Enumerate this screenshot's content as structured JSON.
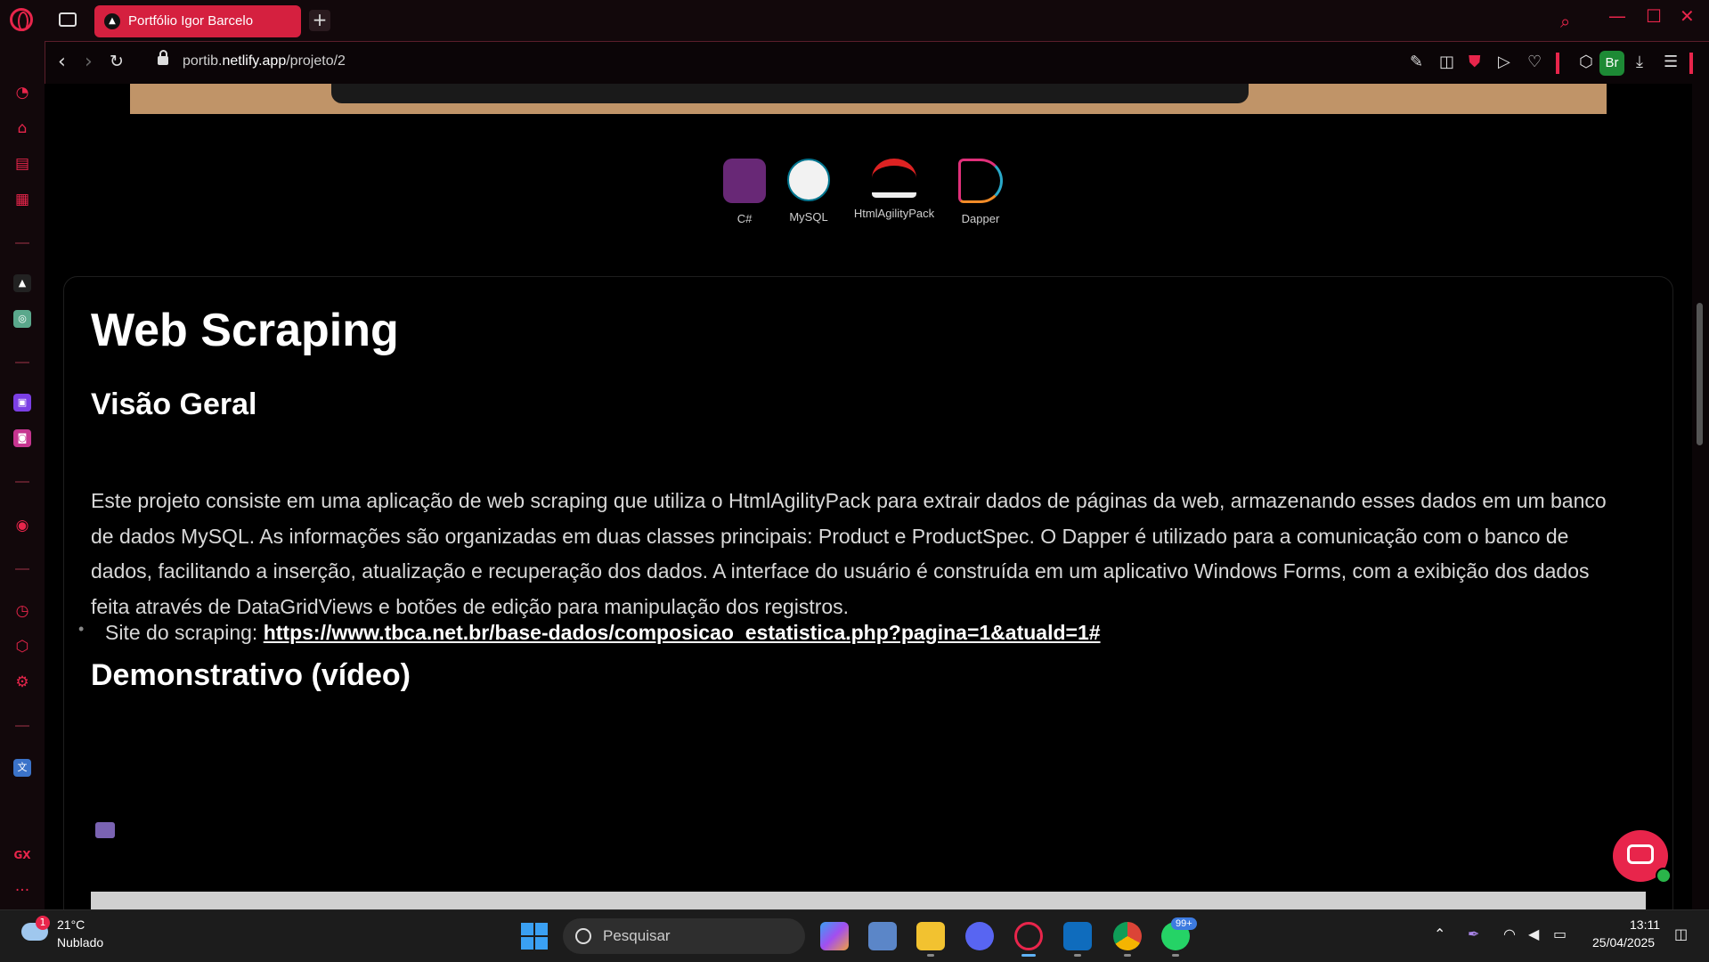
{
  "browser": {
    "tab_title": "Portfólio Igor Barcelo",
    "new_tab_label": "+",
    "url_domain_prefix": "portib.",
    "url_domain": "netlify.app",
    "url_path": "/projeto/2",
    "profile_initials": "Br",
    "accent_color": "#e8254b",
    "sidebar_label_gx": "GX",
    "sidebar_more": "···"
  },
  "page": {
    "technologies": [
      {
        "name": "C#",
        "icon": "csharp-logo"
      },
      {
        "name": "MySQL",
        "icon": "mysql-logo"
      },
      {
        "name": "HtmlAgilityPack",
        "icon": "htmlagilitypack-logo"
      },
      {
        "name": "Dapper",
        "icon": "dapper-logo"
      }
    ],
    "title": "Web Scraping",
    "overview_heading": "Visão Geral",
    "overview_text": "Este projeto consiste em uma aplicação de web scraping que utiliza o HtmlAgilityPack para extrair dados de páginas da web, armazenando esses dados em um banco de dados MySQL. As informações são organizadas em duas classes principais: Product e ProductSpec. O Dapper é utilizado para a comunicação com o banco de dados, facilitando a inserção, atualização e recuperação dos dados. A interface do usuário é construída em um aplicativo Windows Forms, com a exibição dos dados feita através de DataGridViews e botões de edição para manipulação dos registros.",
    "site_label": "Site do scraping: ",
    "site_link": "https://www.tbca.net.br/base-dados/composicao_estatistica.php?pagina=1&atuald=1#",
    "demo_heading": "Demonstrativo (vídeo)"
  },
  "taskbar": {
    "weather_temp": "21°C",
    "weather_desc": "Nublado",
    "weather_badge": "1",
    "search_placeholder": "Pesquisar",
    "whatsapp_badge": "99+",
    "time": "13:11",
    "date": "25/04/2025"
  }
}
